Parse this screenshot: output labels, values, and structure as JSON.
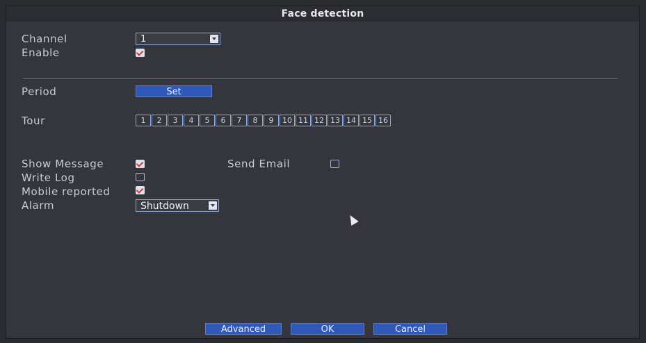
{
  "window": {
    "title": "Face detection"
  },
  "fields": {
    "channel": {
      "label": "Channel",
      "value": "1"
    },
    "enable": {
      "label": "Enable",
      "checked": true
    },
    "period": {
      "label": "Period",
      "button": "Set"
    },
    "tour": {
      "label": "Tour",
      "items": [
        "1",
        "2",
        "3",
        "4",
        "5",
        "6",
        "7",
        "8",
        "9",
        "10",
        "11",
        "12",
        "13",
        "14",
        "15",
        "16"
      ]
    },
    "show_message": {
      "label": "Show Message",
      "checked": true
    },
    "send_email": {
      "label": "Send Email",
      "checked": false
    },
    "write_log": {
      "label": "Write Log",
      "checked": false
    },
    "mobile_reported": {
      "label": "Mobile reported",
      "checked": true
    },
    "alarm": {
      "label": "Alarm",
      "value": "Shutdown"
    }
  },
  "buttons": {
    "advanced": "Advanced",
    "ok": "OK",
    "cancel": "Cancel"
  },
  "icons": {
    "dropdown": "chevron-down-icon",
    "checkbox_checked": "check-icon",
    "cursor": "pointer-icon"
  }
}
